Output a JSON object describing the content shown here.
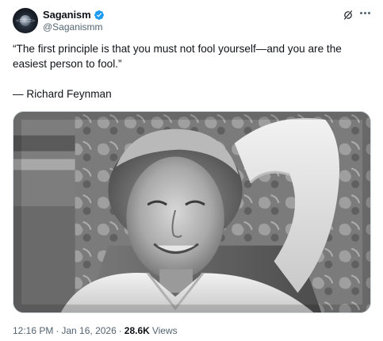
{
  "author": {
    "display_name": "Saganism",
    "handle": "@Saganismm",
    "verified": true,
    "avatar_icon": "saturn-planet-avatar"
  },
  "tweet": {
    "line1": "“The first principle is that you must not fool yourself—and you are the",
    "line2": "easiest person to fool.”",
    "attribution": "— Richard Feynman"
  },
  "media": {
    "kind": "photo",
    "subject": "black-and-white portrait photo"
  },
  "meta": {
    "time": "12:16 PM",
    "sep1": "·",
    "date": "Jan 16, 2026",
    "sep2": "·",
    "views_count": "28.6K",
    "views_label": "Views"
  },
  "colors": {
    "text_primary": "#0f1419",
    "text_secondary": "#536471",
    "verified_blue": "#1d9bf0",
    "border": "#cfd9de"
  },
  "icons": {
    "verified": "verified-badge-icon",
    "grok": "grok-icon",
    "more": "more-options-icon"
  }
}
